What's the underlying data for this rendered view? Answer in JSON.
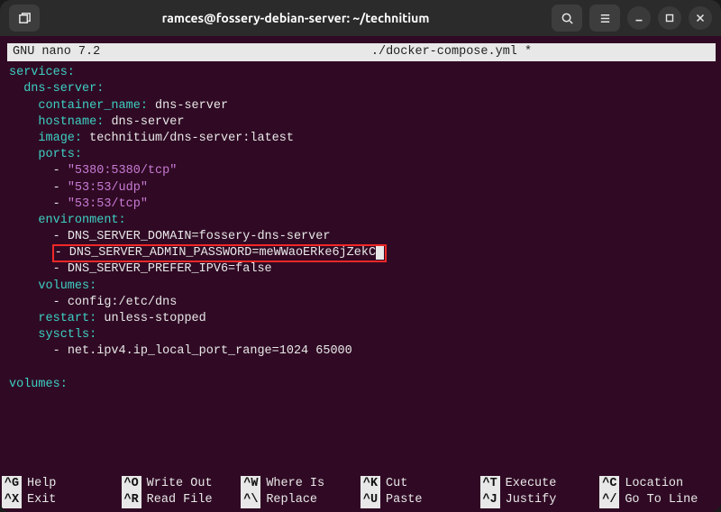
{
  "titlebar": {
    "title": "ramces@fossery-debian-server: ~/technitium"
  },
  "nano": {
    "app": "GNU nano 7.2",
    "filename": "./docker-compose.yml *"
  },
  "lines": {
    "l0": "services:",
    "l1_key": "dns-server",
    "l2_key": "container_name",
    "l2_val": "dns-server",
    "l3_key": "hostname",
    "l3_val": "dns-server",
    "l4_key": "image",
    "l4_val": "technitium/dns-server:latest",
    "l5_key": "ports",
    "p1": "\"5380:5380/tcp\"",
    "p2": "\"53:53/udp\"",
    "p3": "\"53:53/tcp\"",
    "l9_key": "environment",
    "e1": "DNS_SERVER_DOMAIN=fossery-dns-server",
    "e2_pre": "- DNS_SERVER_ADMIN_PASSWORD=meWWaoERke6jZekC",
    "e3": "DNS_SERVER_PREFER_IPV6=false",
    "l13_key": "volumes",
    "v1": "config:/etc/dns",
    "l15_key": "restart",
    "l15_val": "unless-stopped",
    "l16_key": "sysctls",
    "s1": "net.ipv4.ip_local_port_range=1024 65000",
    "vol_key": "volumes"
  },
  "shortcuts": [
    {
      "key": "^G",
      "label": "Help"
    },
    {
      "key": "^O",
      "label": "Write Out"
    },
    {
      "key": "^W",
      "label": "Where Is"
    },
    {
      "key": "^K",
      "label": "Cut"
    },
    {
      "key": "^T",
      "label": "Execute"
    },
    {
      "key": "^C",
      "label": "Location"
    },
    {
      "key": "^X",
      "label": "Exit"
    },
    {
      "key": "^R",
      "label": "Read File"
    },
    {
      "key": "^\\",
      "label": "Replace"
    },
    {
      "key": "^U",
      "label": "Paste"
    },
    {
      "key": "^J",
      "label": "Justify"
    },
    {
      "key": "^/",
      "label": "Go To Line"
    }
  ]
}
